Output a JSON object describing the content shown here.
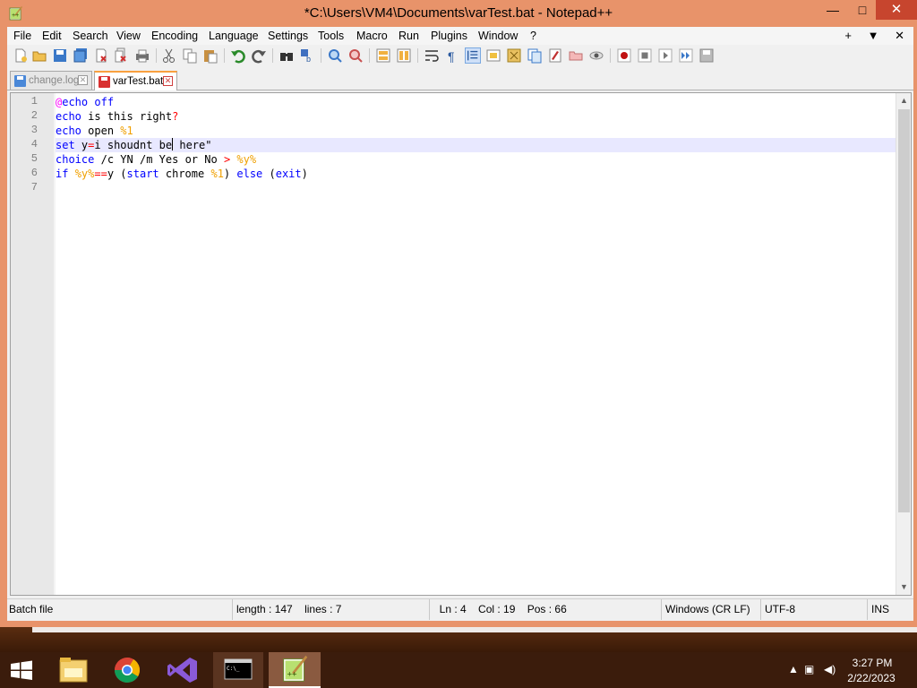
{
  "window": {
    "title": "*C:\\Users\\VM4\\Documents\\varTest.bat - Notepad++",
    "min_glyph": "—",
    "max_glyph": "□",
    "close_glyph": "✕"
  },
  "menu": {
    "items": [
      "File",
      "Edit",
      "Search",
      "View",
      "Encoding",
      "Language",
      "Settings",
      "Tools",
      "Macro",
      "Run",
      "Plugins",
      "Window",
      "?"
    ],
    "right": [
      "+",
      "▼",
      "✕"
    ]
  },
  "tabs": [
    {
      "label": "change.log",
      "active": false
    },
    {
      "label": "varTest.bat",
      "active": true,
      "modified": true
    }
  ],
  "editor": {
    "line_numbers": [
      "1",
      "2",
      "3",
      "4",
      "5",
      "6",
      "7"
    ],
    "current_line": 4,
    "lines": [
      "@echo off",
      "echo is this right?",
      "echo open %1",
      "set y=i shoudnt be here\"",
      "choice /c YN /m Yes or No > %y%",
      "if %y%==y (start chrome %1) else (exit)",
      ""
    ]
  },
  "statusbar": {
    "file_type": "Batch file",
    "length": "length : 147",
    "lines": "lines : 7",
    "ln": "Ln : 4",
    "col": "Col : 19",
    "pos": "Pos : 66",
    "eol": "Windows (CR LF)",
    "encoding": "UTF-8",
    "mode": "INS"
  },
  "taskbar": {
    "time": "3:27 PM",
    "date": "2/22/2023",
    "apps": [
      "file-explorer",
      "chrome",
      "visual-studio",
      "command-prompt",
      "notepad-plus-plus"
    ]
  },
  "colors": {
    "frame": "#e8936a",
    "keyword": "#0000ff",
    "at_sign": "#ff00ff",
    "operator": "#ff0000",
    "variable": "#f0a000",
    "current_line": "#e8e8ff"
  }
}
